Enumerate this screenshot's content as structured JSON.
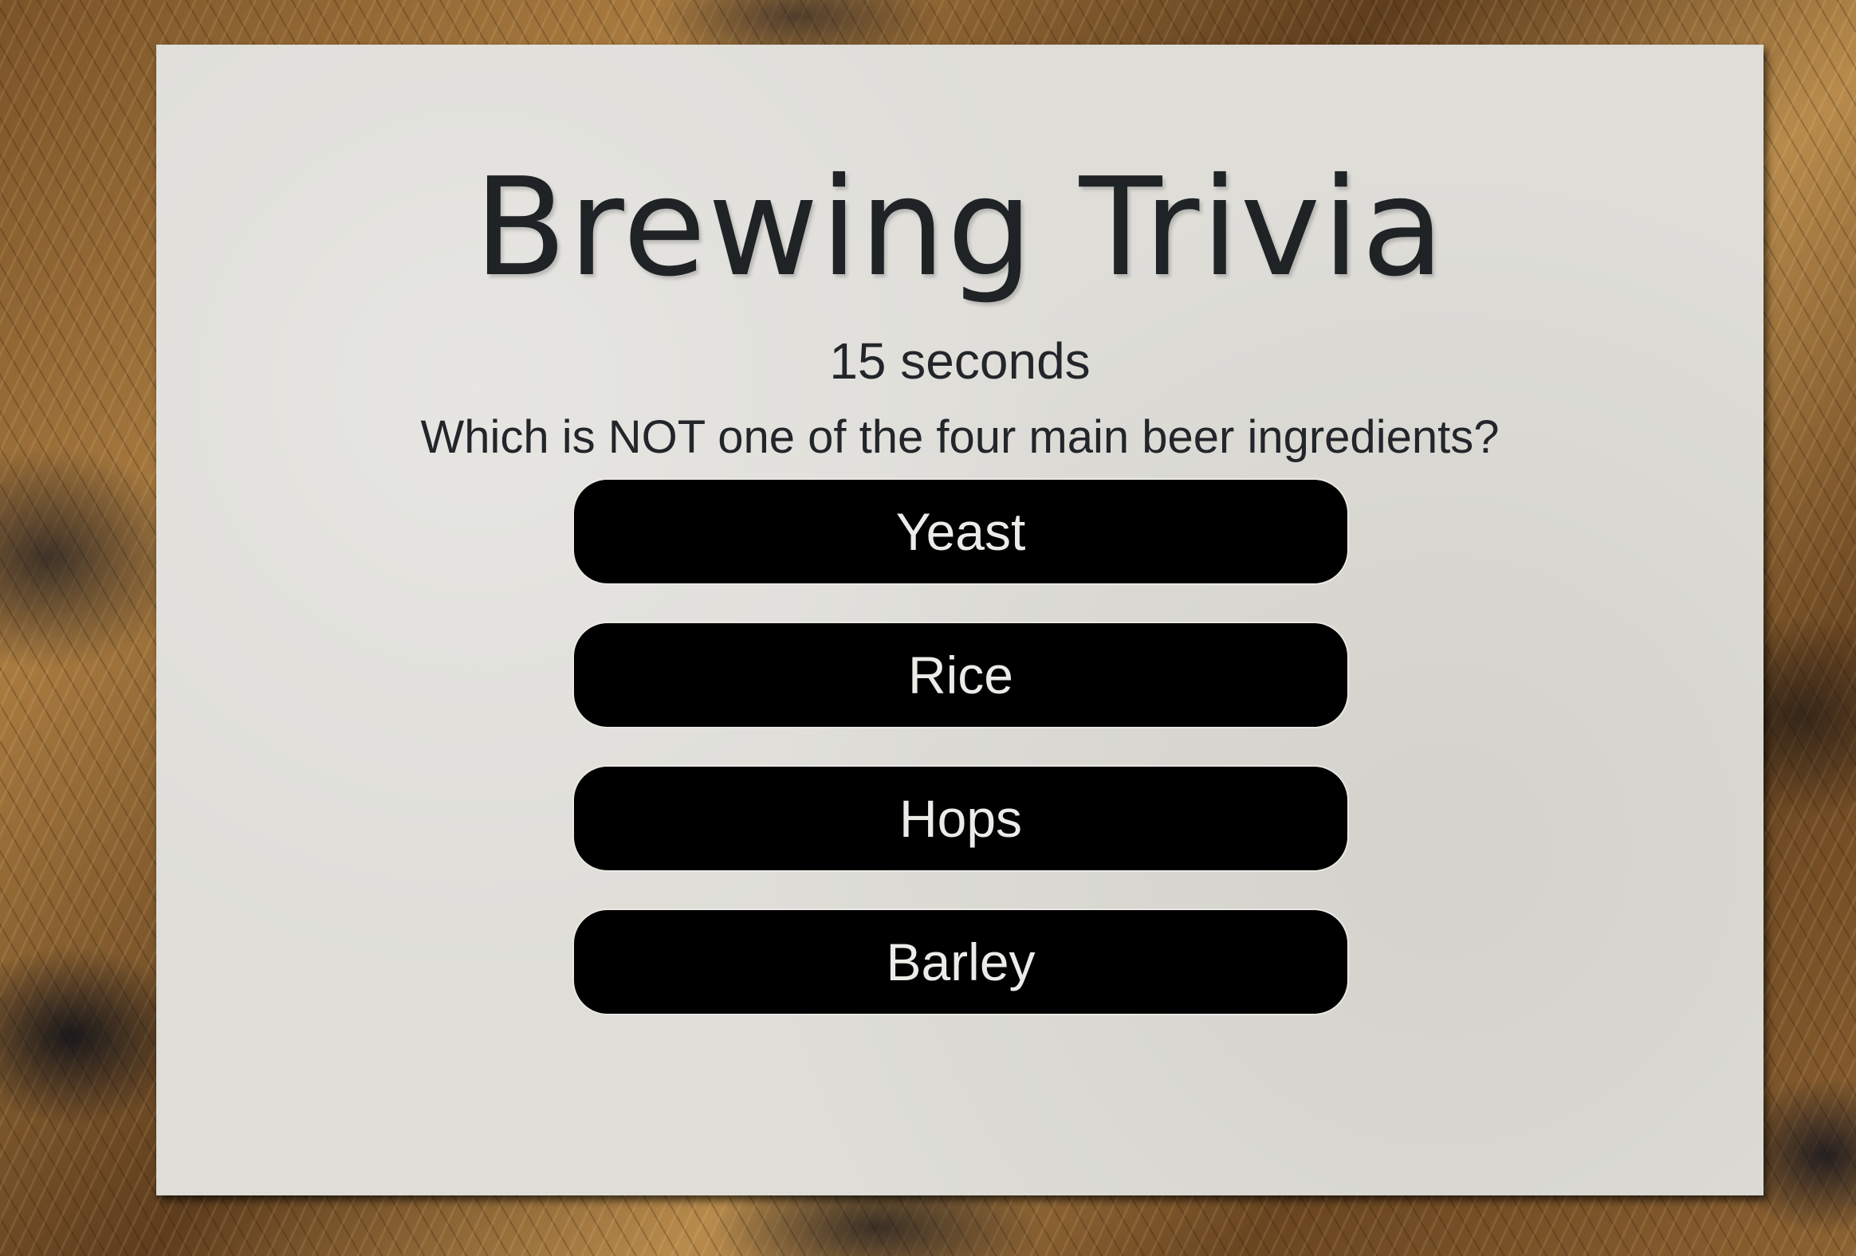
{
  "quiz": {
    "title": "Brewing Trivia",
    "timer": "15 seconds",
    "question": "Which is NOT one of the four main beer ingredients?",
    "answers": [
      "Yeast",
      "Rice",
      "Hops",
      "Barley"
    ]
  },
  "colors": {
    "card_background": "#deddd8",
    "button_background": "#000000",
    "button_text": "#ebebe8",
    "text": "#222529"
  }
}
